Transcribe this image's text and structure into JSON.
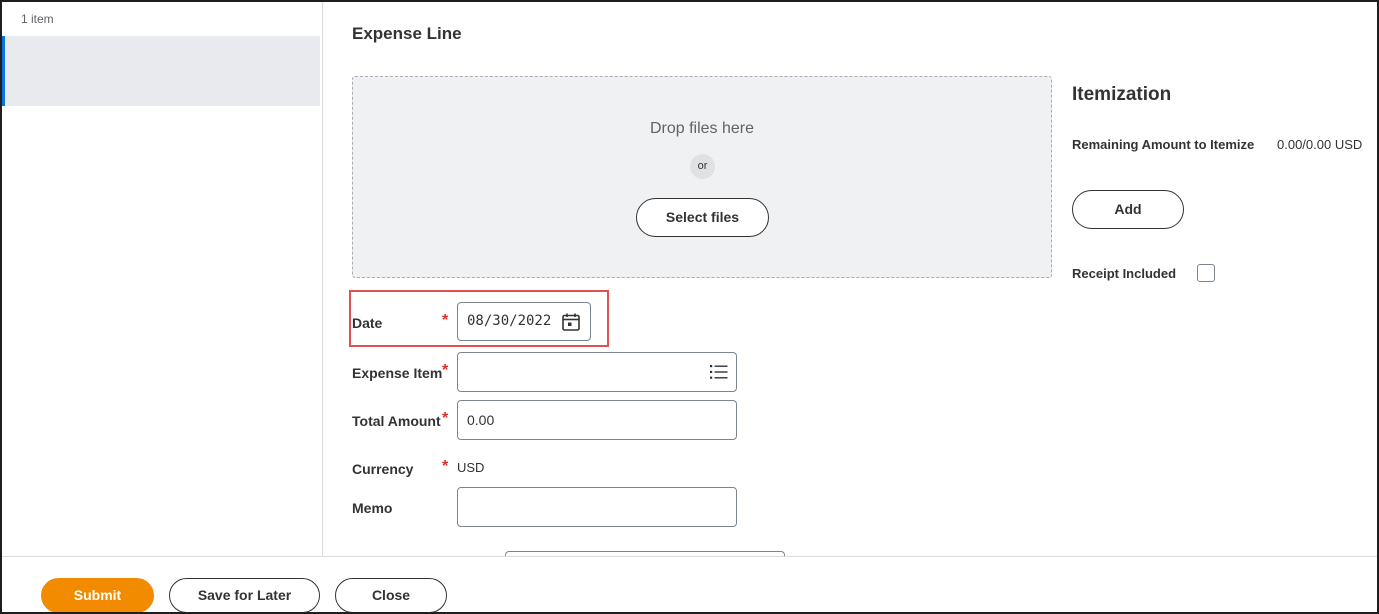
{
  "sidebar": {
    "count_label": "1 item"
  },
  "main": {
    "title": "Expense Line"
  },
  "dropzone": {
    "text": "Drop files here",
    "or": "or",
    "button_label": "Select files"
  },
  "form": {
    "date": {
      "label": "Date",
      "required": "*",
      "value": "08/30/2022"
    },
    "expense_item": {
      "label": "Expense Item",
      "required": "*",
      "value": ""
    },
    "total_amount": {
      "label": "Total Amount",
      "required": "*",
      "value": "0.00"
    },
    "currency": {
      "label": "Currency",
      "required": "*",
      "value": "USD"
    },
    "memo": {
      "label": "Memo",
      "value": ""
    }
  },
  "itemization": {
    "title": "Itemization",
    "remaining_label": "Remaining Amount to Itemize",
    "remaining_value": "0.00/0.00 USD",
    "add_label": "Add",
    "receipt_label": "Receipt Included"
  },
  "footer": {
    "submit": "Submit",
    "save_later": "Save for Later",
    "close": "Close"
  },
  "colors": {
    "accent_orange": "#f38b00",
    "required_red": "#de2e21",
    "highlight_red": "#e05252",
    "selection_blue": "#0875e1"
  },
  "icons": {
    "date_picker": "calendar-icon",
    "expense_item_prompt": "list-icon"
  }
}
